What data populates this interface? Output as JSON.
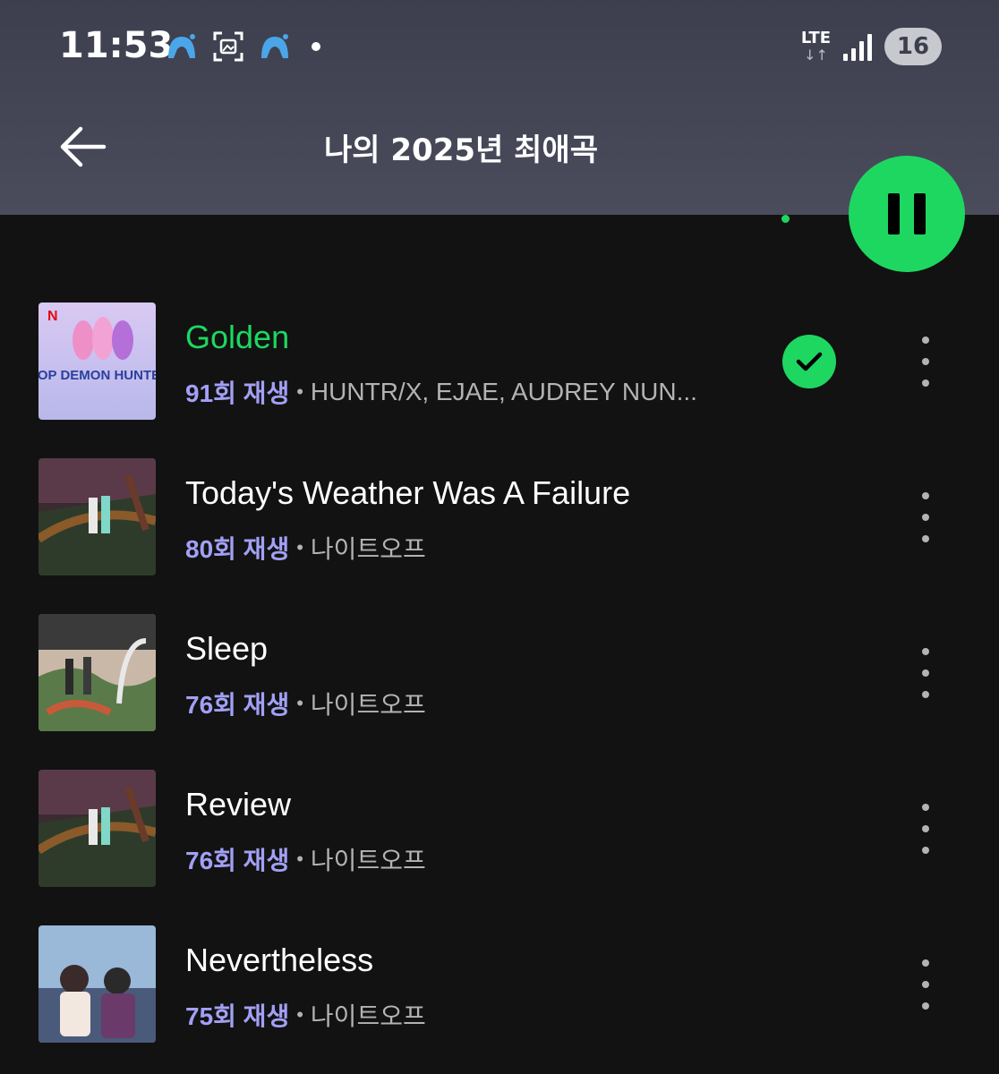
{
  "status_bar": {
    "time": "11:53",
    "network": "LTE",
    "network_arrows": "↓↑",
    "battery": "16"
  },
  "header": {
    "title": "나의 2025년 최애곡"
  },
  "colors": {
    "accent": "#1ed760",
    "plays": "#a2a0f5",
    "secondary_text": "#b3b3b3",
    "background": "#121212",
    "header_bg": "#4a4c5c"
  },
  "tracks": [
    {
      "title": "Golden",
      "plays": "91회 재생",
      "separator": "•",
      "artist": "HUNTR/X, EJAE, AUDREY NUN...",
      "active": true,
      "downloaded": true,
      "art_text": "K-POP DEMON HUNTERS",
      "art_badge": "N"
    },
    {
      "title": "Today's Weather Was A Failure",
      "plays": "80회 재생",
      "separator": "•",
      "artist": "나이트오프",
      "active": false,
      "downloaded": false
    },
    {
      "title": "Sleep",
      "plays": "76회 재생",
      "separator": "•",
      "artist": "나이트오프",
      "active": false,
      "downloaded": false
    },
    {
      "title": "Review",
      "plays": "76회 재생",
      "separator": "•",
      "artist": "나이트오프",
      "active": false,
      "downloaded": false
    },
    {
      "title": "Nevertheless",
      "plays": "75회 재생",
      "separator": "•",
      "artist": "나이트오프",
      "active": false,
      "downloaded": false
    }
  ]
}
